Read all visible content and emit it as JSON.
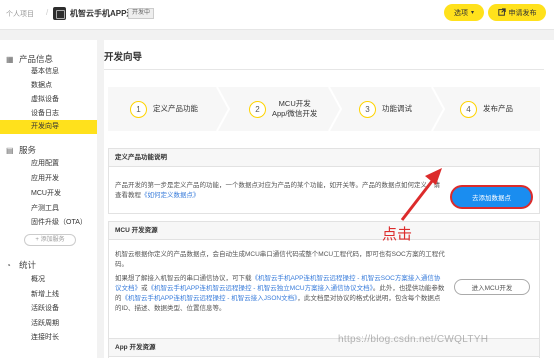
{
  "header": {
    "breadcrumb_home": "个人项目",
    "breadcrumb_sep": "/",
    "app_name": "机智云手机APP连机...",
    "badge": "开发中",
    "options_label": "选项",
    "options_caret": "▾",
    "publish_label": "申请发布",
    "publish_icon": "external-link-icon"
  },
  "sidebar": {
    "groups": [
      {
        "icon": "product-info-icon",
        "glyph": "▦",
        "label": "产品信息",
        "items": [
          "基本信息",
          "数据点",
          "虚拟设备",
          "设备日志",
          "开发向导"
        ]
      },
      {
        "icon": "service-icon",
        "glyph": "▤",
        "label": "服务",
        "items": [
          "应用配置",
          "应用开发",
          "MCU开发",
          "产测工具",
          "固件升级（OTA）"
        ]
      },
      {
        "icon": "stats-icon",
        "glyph": "◔",
        "label": "统计",
        "items": [
          "概况",
          "新增上线",
          "活跃设备",
          "活跃周期",
          "连接时长"
        ]
      }
    ],
    "active_item": "开发向导",
    "add_service": "+ 添加服务"
  },
  "main": {
    "title": "开发向导",
    "steps": [
      {
        "num": "1",
        "label": "定义产品功能"
      },
      {
        "num": "2",
        "label": "MCU开发\nApp/微信开发"
      },
      {
        "num": "3",
        "label": "功能调试"
      },
      {
        "num": "4",
        "label": "发布产品"
      }
    ],
    "define_panel": {
      "heading": "定义产品功能说明",
      "text": "产品开发的第一步是定义产品的功能，一个数据点对应为产品的某个功能，如开关等。产品的数据点如何定义，请查看教程",
      "link": "《如何定义数据点》",
      "button": "去添加数据点"
    },
    "mcu_panel": {
      "heading": "MCU 开发资源",
      "text1": "机智云根据你定义的产品数据点，会自动生成MCU串口通信代码或整个MCU工程代码，即可也有SOC方案的工程代码。",
      "text2_a": "如果想了解接入机智云的串口通信协议，可下载",
      "text2_link1": "《机智云手机APP连机智云远程操控 - 机智云SOC方案接入通信协议文档》",
      "text2_b": "或",
      "text2_link2": "《机智云手机APP连机智云远程操控 - 机智云独立MCU方案接入通信协议文档》",
      "text2_c": "。此外，也提供功能参数的",
      "text2_link3": "《机智云手机APP连机智云远程操控 - 机智云接入JSON文档》",
      "text2_d": "，此文档是对协议的格式化说明，包含每个数据点的ID、描述、数据类型、位置信息等。",
      "button": "进入MCU开发"
    },
    "app_panel": {
      "heading": "App 开发资源"
    }
  },
  "annotation": {
    "label": "点击"
  },
  "watermark": "https://blog.csdn.net/CWQLTYH"
}
